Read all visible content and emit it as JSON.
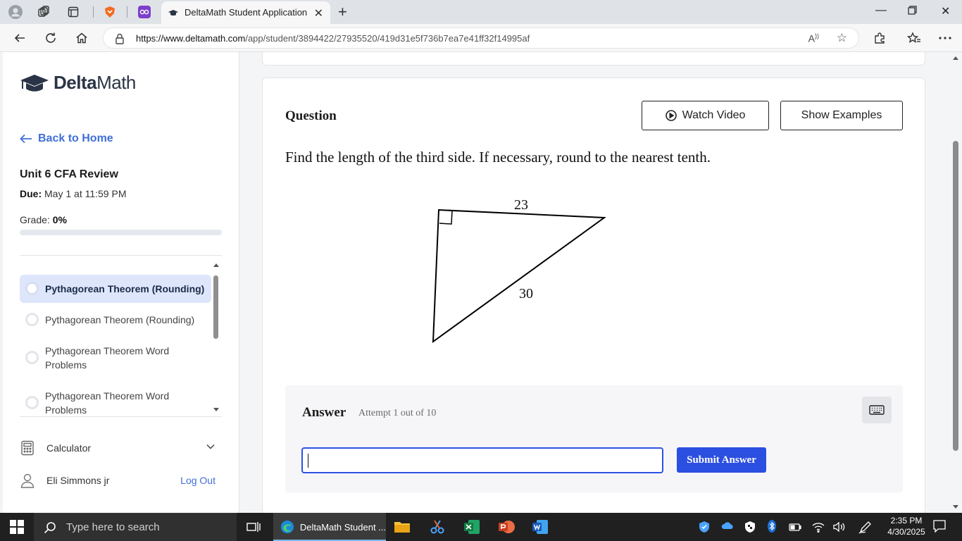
{
  "browser": {
    "tab_title": "DeltaMath Student Application",
    "url_host": "https://www.deltamath.com",
    "url_path": "/app/student/3894422/27935520/419d31e5f736b7ea7e41ff32f14995af"
  },
  "sidebar": {
    "logo_bold": "Delta",
    "logo_light": "Math",
    "back_label": "Back to Home",
    "unit_title": "Unit 6 CFA Review",
    "due_label": "Due:",
    "due_value": "May 1 at 11:59 PM",
    "grade_label": "Grade:",
    "grade_value": "0%",
    "grade_fraction": 0,
    "problems": [
      {
        "label": "Pythagorean Theorem (Rounding)",
        "active": true
      },
      {
        "label": "Pythagorean Theorem (Rounding)",
        "active": false
      },
      {
        "label": "Pythagorean Theorem Word Problems",
        "active": false
      },
      {
        "label": "Pythagorean Theorem Word Problems",
        "active": false
      }
    ],
    "calculator_label": "Calculator",
    "user_name": "Eli Simmons jr",
    "logout_label": "Log Out"
  },
  "question": {
    "header": "Question",
    "watch_video_label": "Watch Video",
    "show_examples_label": "Show Examples",
    "prompt": "Find the length of the third side. If necessary, round to the nearest tenth.",
    "side_top_label": "23",
    "side_hyp_label": "30"
  },
  "answer": {
    "header": "Answer",
    "attempt_text": "Attempt 1 out of 10",
    "input_value": "",
    "submit_label": "Submit Answer"
  },
  "taskbar": {
    "search_placeholder": "Type here to search",
    "edge_label": "DeltaMath Student ...",
    "time": "2:35 PM",
    "date": "4/30/2025"
  },
  "colors": {
    "accent_blue": "#2b4fe0",
    "link_blue": "#3f6fd8",
    "active_item_bg": "#dde6fb"
  }
}
